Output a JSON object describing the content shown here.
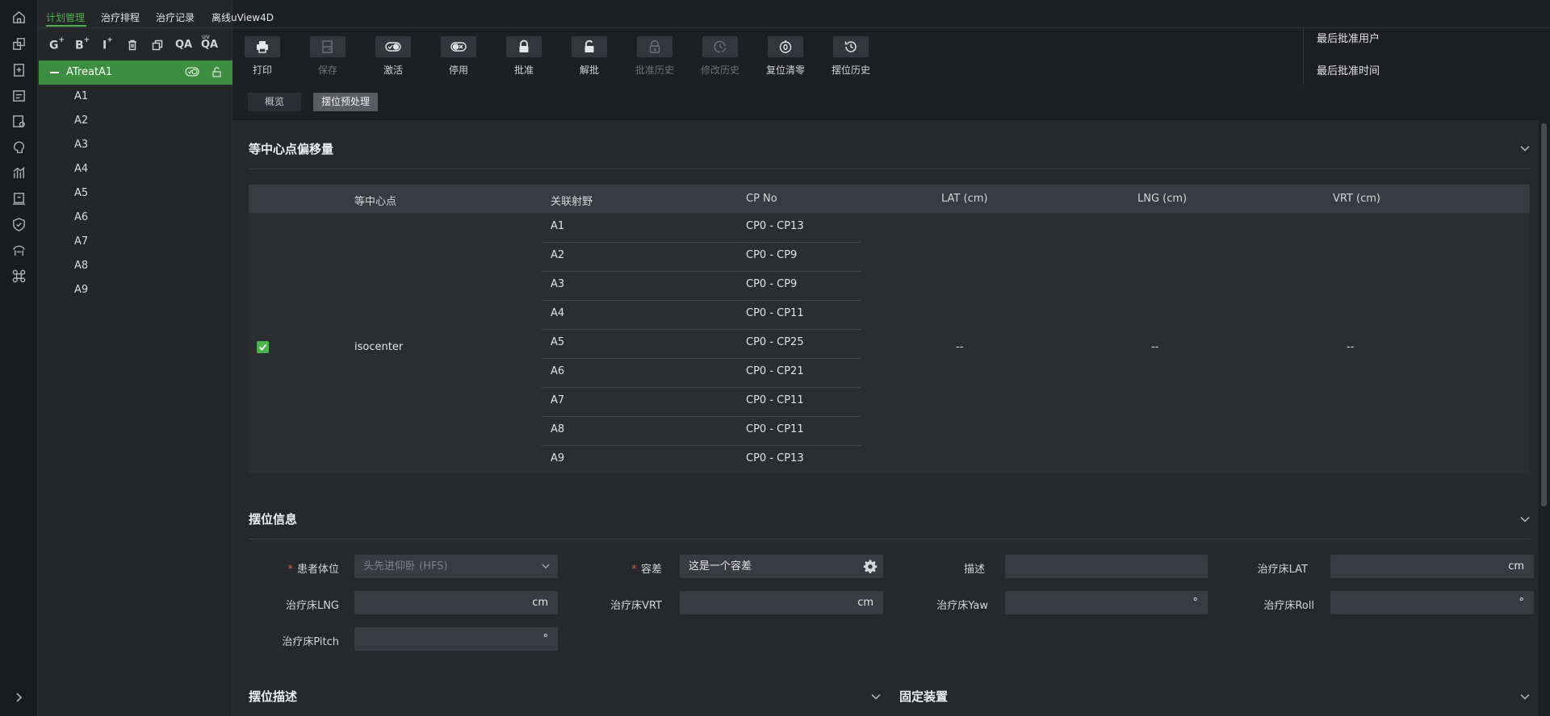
{
  "nav": {
    "tabs": [
      {
        "label": "计划管理"
      },
      {
        "label": "治疗排程"
      },
      {
        "label": "治疗记录"
      },
      {
        "label": "离线uView4D"
      }
    ]
  },
  "tree_toolbar": {
    "g": "G",
    "b": "B",
    "i": "I",
    "qa": "QA",
    "qa2": "QA",
    "plus": "+",
    "uv": "uv"
  },
  "tree": {
    "plan": "ATreatA1",
    "fields": [
      "A1",
      "A2",
      "A3",
      "A4",
      "A5",
      "A6",
      "A7",
      "A8",
      "A9"
    ]
  },
  "toolbar": {
    "print": "打印",
    "save": "保存",
    "activate": "激活",
    "deactivate": "停用",
    "approve": "批准",
    "unapprove": "解批",
    "approval_history": "批准历史",
    "edit_history": "修改历史",
    "reset": "复位清零",
    "setup_history": "摆位历史"
  },
  "approval": {
    "user_label": "最后批准用户",
    "time_label": "最后批准时间"
  },
  "subtabs": {
    "overview": "概览",
    "setup": "摆位预处理"
  },
  "isocenter_section": {
    "title": "等中心点偏移量",
    "headers": [
      "等中心点",
      "关联射野",
      "CP No",
      "LAT (cm)",
      "LNG (cm)",
      "VRT (cm)"
    ],
    "isocenter": "isocenter",
    "rows": [
      {
        "field": "A1",
        "cp": "CP0 - CP13"
      },
      {
        "field": "A2",
        "cp": "CP0 - CP9"
      },
      {
        "field": "A3",
        "cp": "CP0 - CP9"
      },
      {
        "field": "A4",
        "cp": "CP0 - CP11"
      },
      {
        "field": "A5",
        "cp": "CP0 - CP25"
      },
      {
        "field": "A6",
        "cp": "CP0 - CP21"
      },
      {
        "field": "A7",
        "cp": "CP0 - CP11"
      },
      {
        "field": "A8",
        "cp": "CP0 - CP11"
      },
      {
        "field": "A9",
        "cp": "CP0 - CP13"
      }
    ],
    "lat": "--",
    "lng": "--",
    "vrt": "--",
    "checked": true
  },
  "setup_section": {
    "title": "摆位信息",
    "required_mark": "*",
    "patient_position_label": "患者体位",
    "patient_position_value": "头先进仰卧 (HFS)",
    "tolerance_label": "容差",
    "tolerance_value": "这是一个容差",
    "description_label": "描述",
    "description_value": "",
    "couch_lat_label": "治疗床LAT",
    "couch_lng_label": "治疗床LNG",
    "couch_vrt_label": "治疗床VRT",
    "couch_yaw_label": "治疗床Yaw",
    "couch_roll_label": "治疗床Roll",
    "couch_pitch_label": "治疗床Pitch",
    "unit_cm": "cm",
    "unit_deg": "°"
  },
  "bottom": {
    "setup_desc_title": "摆位描述",
    "fixture_title": "固定装置"
  },
  "colors": {
    "accent": "#4cb34c",
    "plan_row": "#3e8e41",
    "required": "#e35b3c"
  },
  "icons": [
    "home-icon",
    "plan-icon",
    "clipboard-plus-icon",
    "schedule-icon",
    "record-icon",
    "brain-icon",
    "stats-icon",
    "report-icon",
    "shield-icon",
    "machine-icon",
    "command-icon",
    "expand-icon"
  ]
}
